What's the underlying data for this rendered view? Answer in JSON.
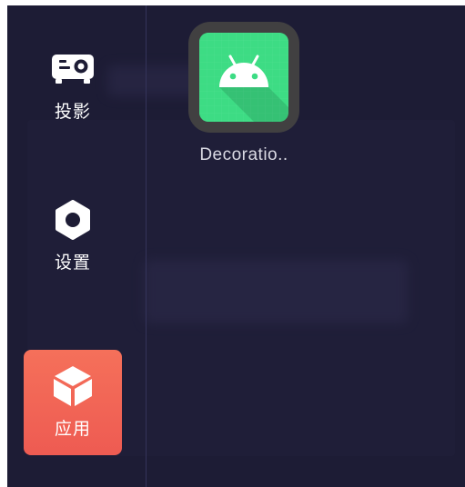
{
  "sidebar": {
    "items": [
      {
        "label": "投影",
        "icon": "projector-icon",
        "active": false
      },
      {
        "label": "设置",
        "icon": "gear-icon",
        "active": false
      },
      {
        "label": "应用",
        "icon": "cube-icon",
        "active": true
      }
    ]
  },
  "apps": [
    {
      "label": "Decoratio..",
      "icon": "android-icon"
    }
  ],
  "colors": {
    "background": "#1d1c35",
    "active_item": "#f1624f",
    "app_icon_green": "#3ddc84"
  }
}
